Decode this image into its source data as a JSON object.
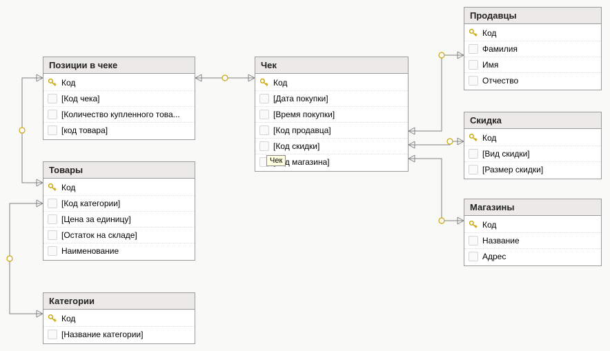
{
  "tooltip": "Чек",
  "tables": {
    "positions": {
      "title": "Позиции в чеке",
      "fields": [
        {
          "key": true,
          "label": "Код"
        },
        {
          "key": false,
          "label": "[Код чека]"
        },
        {
          "key": false,
          "label": "[Количество купленного това..."
        },
        {
          "key": false,
          "label": "[код товара]"
        }
      ]
    },
    "goods": {
      "title": "Товары",
      "fields": [
        {
          "key": true,
          "label": "Код"
        },
        {
          "key": false,
          "label": "[Код категории]"
        },
        {
          "key": false,
          "label": "[Цена за единицу]"
        },
        {
          "key": false,
          "label": "[Остаток на складе]"
        },
        {
          "key": false,
          "label": "Наименование"
        }
      ]
    },
    "categories": {
      "title": "Категории",
      "fields": [
        {
          "key": true,
          "label": "Код"
        },
        {
          "key": false,
          "label": "[Название категории]"
        }
      ]
    },
    "check": {
      "title": "Чек",
      "fields": [
        {
          "key": true,
          "label": "Код"
        },
        {
          "key": false,
          "label": "[Дата покупки]"
        },
        {
          "key": false,
          "label": "[Время покупки]"
        },
        {
          "key": false,
          "label": "[Код продавца]"
        },
        {
          "key": false,
          "label": "[Код скидки]"
        },
        {
          "key": false,
          "label": "[Код магазина]"
        }
      ]
    },
    "sellers": {
      "title": "Продавцы",
      "fields": [
        {
          "key": true,
          "label": "Код"
        },
        {
          "key": false,
          "label": "Фамилия"
        },
        {
          "key": false,
          "label": "Имя"
        },
        {
          "key": false,
          "label": "Отчество"
        }
      ]
    },
    "discount": {
      "title": "Скидка",
      "fields": [
        {
          "key": true,
          "label": "Код"
        },
        {
          "key": false,
          "label": "[Вид скидки]"
        },
        {
          "key": false,
          "label": "[Размер скидки]"
        }
      ]
    },
    "shops": {
      "title": "Магазины",
      "fields": [
        {
          "key": true,
          "label": "Код"
        },
        {
          "key": false,
          "label": "Название"
        },
        {
          "key": false,
          "label": "Адрес"
        }
      ]
    }
  }
}
